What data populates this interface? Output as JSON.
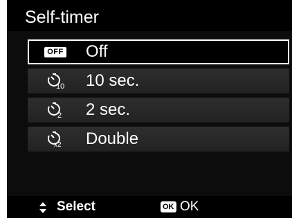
{
  "header": {
    "title": "Self-timer"
  },
  "menu": {
    "items": [
      {
        "icon": "off-icon",
        "icon_text": "OFF",
        "label": "Off",
        "selected": true
      },
      {
        "icon": "timer-10-sec-icon",
        "label": "10 sec.",
        "selected": false
      },
      {
        "icon": "timer-2-sec-icon",
        "label": "2 sec.",
        "selected": false
      },
      {
        "icon": "timer-double-icon",
        "label": "Double",
        "selected": false
      }
    ]
  },
  "footer": {
    "select_icon": "up-down-arrows-icon",
    "select_label": "Select",
    "ok_icon_text": "OK",
    "ok_label": "OK"
  },
  "colors": {
    "background": "#0c0c0c",
    "text": "#ffffff",
    "item": "#2a2a2a",
    "selection_border": "#ffffff"
  }
}
